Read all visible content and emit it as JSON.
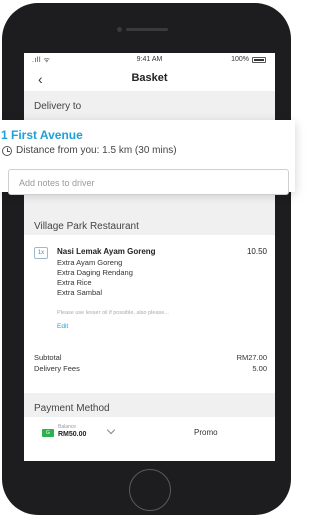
{
  "status_bar": {
    "signal": ".ıll ᯤ",
    "time": "9:41 AM",
    "battery": "100%"
  },
  "nav": {
    "title": "Basket",
    "back_icon": "chevron-left-icon"
  },
  "delivery": {
    "section_label": "Delivery to",
    "address": "1 First Avenue",
    "distance": "Distance from you: 1.5 km (30 mins)",
    "notes_placeholder": "Add notes to driver"
  },
  "restaurant": {
    "name": "Village Park Restaurant"
  },
  "order": {
    "items": [
      {
        "qty": "1x",
        "name": "Nasi Lemak Ayam Goreng",
        "price": "10.50",
        "extras": [
          "Extra Ayam Goreng",
          "Extra Daging Rendang",
          "Extra Rice",
          "Extra Sambal"
        ],
        "note": "Please use lesser oil if possible, also please...",
        "edit_label": "Edit"
      }
    ],
    "subtotal_label": "Subtotal",
    "subtotal_value": "RM27.00",
    "delivery_fees_label": "Delivery Fees",
    "delivery_fees_value": "5.00"
  },
  "payment": {
    "title": "Payment Method",
    "wallet_icon_text": "G",
    "balance_label": "Balance",
    "balance_value": "RM50.00",
    "promo_label": "Promo"
  },
  "colors": {
    "accent": "#1ea0d8",
    "wallet_green": "#2bb24c"
  }
}
